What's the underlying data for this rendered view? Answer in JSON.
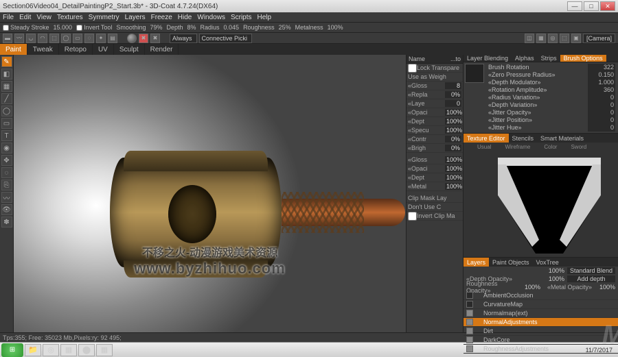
{
  "window": {
    "title": "Section06Video04_DetailPaintingP2_Start.3b* - 3D-Coat 4.7.24(DX64)"
  },
  "menu": [
    "File",
    "Edit",
    "View",
    "Textures",
    "Symmetry",
    "Layers",
    "Freeze",
    "Hide",
    "Windows",
    "Scripts",
    "Help"
  ],
  "ribbon": {
    "steady_stroke": "Steady Stroke",
    "stroke_val": "15.000",
    "invert_tool": "Invert Tool",
    "smoothing": "Smoothing",
    "smoothing_val": "79%",
    "depth": "Depth",
    "depth_val": "8%",
    "radius": "Radius",
    "radius_val": "0.045",
    "roughness": "Roughness",
    "roughness_val": "25%",
    "metalness": "Metalness",
    "metalness_val": "100%"
  },
  "iconrow": {
    "always": "Always",
    "connective": "Connective Picki",
    "camera": "Camera"
  },
  "tabs": [
    "Paint",
    "Tweak",
    "Retopo",
    "UV",
    "Sculpt",
    "Render"
  ],
  "mid": {
    "header_l": "Name",
    "header_r": "...to",
    "lock": "Lock Transpare",
    "weigh": "Use as Weigh",
    "rows": [
      {
        "l": "«Gloss",
        "v": "8"
      },
      {
        "l": "«Repla",
        "v": "0%"
      },
      {
        "l": "«Laye",
        "v": "0"
      },
      {
        "l": "«Opaci",
        "v": "100%"
      },
      {
        "l": "«Dept",
        "v": "100%"
      },
      {
        "l": "«Specu",
        "v": "100%"
      },
      {
        "l": "«Contr",
        "v": "0%"
      },
      {
        "l": "«Brigh",
        "v": "0%"
      }
    ],
    "rows2": [
      {
        "l": "«Gloss",
        "v": "100%"
      },
      {
        "l": "«Opaci",
        "v": "100%"
      },
      {
        "l": "«Dept",
        "v": "100%"
      },
      {
        "l": "«Metal",
        "v": "100%"
      }
    ],
    "clip1": "Clip Mask Lay",
    "clip2": "Don't Use C",
    "clip3": "Invert Clip Ma"
  },
  "right": {
    "tabs": [
      "Layer Blending",
      "Alphas",
      "Strips",
      "Brush Options"
    ],
    "brush": {
      "rows": [
        {
          "l": "Brush Rotation",
          "v": "322"
        },
        {
          "l": "«Zero Pressure Radius»",
          "v": "0.150"
        },
        {
          "l": "«Depth Modulator»",
          "v": "1.000"
        },
        {
          "l": "«Rotation Amplitude»",
          "v": "360"
        },
        {
          "l": "«Radius Variation»",
          "v": "0"
        },
        {
          "l": "«Depth Variation»",
          "v": "0"
        },
        {
          "l": "«Jitter Opacity»",
          "v": "0"
        },
        {
          "l": "«Jitter Position»",
          "v": "0"
        },
        {
          "l": "«Jitter Hue»",
          "v": "0"
        }
      ]
    },
    "tex_tabs": [
      "Texture Editor",
      "Stencils",
      "Smart Materials"
    ],
    "tex_sub": [
      "Usual",
      "Wireframe",
      "Color",
      "Sword"
    ],
    "layers_tabs": [
      "Layers",
      "Paint Objects",
      "VoxTree"
    ],
    "layer_ctrls": [
      {
        "l": "",
        "v": "100%",
        "sel": "Standard Blend"
      },
      {
        "l": "«Depth Opacity»",
        "v": "100%",
        "sel": "Add depth"
      },
      {
        "l": "Roughness Opacity»",
        "v": "100%",
        "l2": "«Metal Opacity»",
        "v2": "100%"
      }
    ],
    "layers": [
      {
        "n": "AmbientOcclusion",
        "on": false,
        "ind": 1
      },
      {
        "n": "CurvatureMap",
        "on": false,
        "ind": 1
      },
      {
        "n": "Normalmap(ext)",
        "on": true,
        "ind": 1
      },
      {
        "n": "NormalAdjustments",
        "on": true,
        "ind": 1,
        "sel": true
      },
      {
        "n": "Dirt",
        "on": true,
        "ind": 1
      },
      {
        "n": "DarkCore",
        "on": true,
        "ind": 1
      },
      {
        "n": "RoughnessAdjustments",
        "on": true,
        "ind": 1
      }
    ]
  },
  "status": "Tps:355;    Free: 35023 Mb,Pixels:ry: 92  495;",
  "watermark": {
    "l1": "不移之火-动漫游戏美术资源",
    "l2": "www.byzhihuo.com"
  },
  "tray": {
    "date": "11/7/2017"
  },
  "icons": {
    "brush": "✎",
    "eraser": "◧",
    "fill": "▦",
    "line": "╱",
    "circle": "◯",
    "rect": "▭",
    "text": "T",
    "pick": "◉",
    "move": "✥",
    "lasso": "◌",
    "clone": "⎘",
    "smudge": "〰",
    "eye": "👁",
    "butterfly": "✽",
    "sym_x": "✖",
    "sym_off": "✖",
    "minimize": "—",
    "maximize": "□",
    "close": "✕",
    "start": "⊞",
    "explorer": "📁",
    "chrome": "◎",
    "obs": "⬤",
    "app": "▦"
  }
}
